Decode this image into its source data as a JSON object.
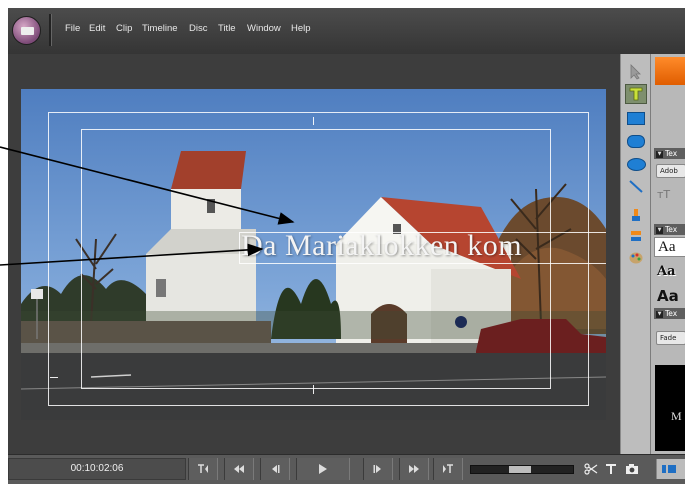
{
  "menubar": {
    "items": [
      "File",
      "Edit",
      "Clip",
      "Timeline",
      "Disc",
      "Title",
      "Window",
      "Help"
    ]
  },
  "title_overlay": {
    "text": "Da Mariaklokken kom"
  },
  "toolbox": {
    "tools": [
      "selection-arrow-icon",
      "text-tool-icon",
      "rectangle-icon",
      "rounded-rectangle-icon",
      "ellipse-icon",
      "line-icon",
      "paint-bucket-icon",
      "layer-order-icon",
      "color-palette-icon"
    ]
  },
  "side_panel": {
    "text_header_1": "Tex",
    "font_dropdown": "Adob",
    "text_header_2": "Tex",
    "sample_1": "Aa",
    "sample_2": "Aa",
    "sample_3": "Aa",
    "text_header_3": "Tex",
    "fade_dropdown": "Fade",
    "preview_letter": "M"
  },
  "transport": {
    "timecode": "00:10:02:06"
  },
  "colors": {
    "menubar_bg": "#404040",
    "accent_orange": "#f07010",
    "monitor_bg": "#3d3d3d"
  }
}
